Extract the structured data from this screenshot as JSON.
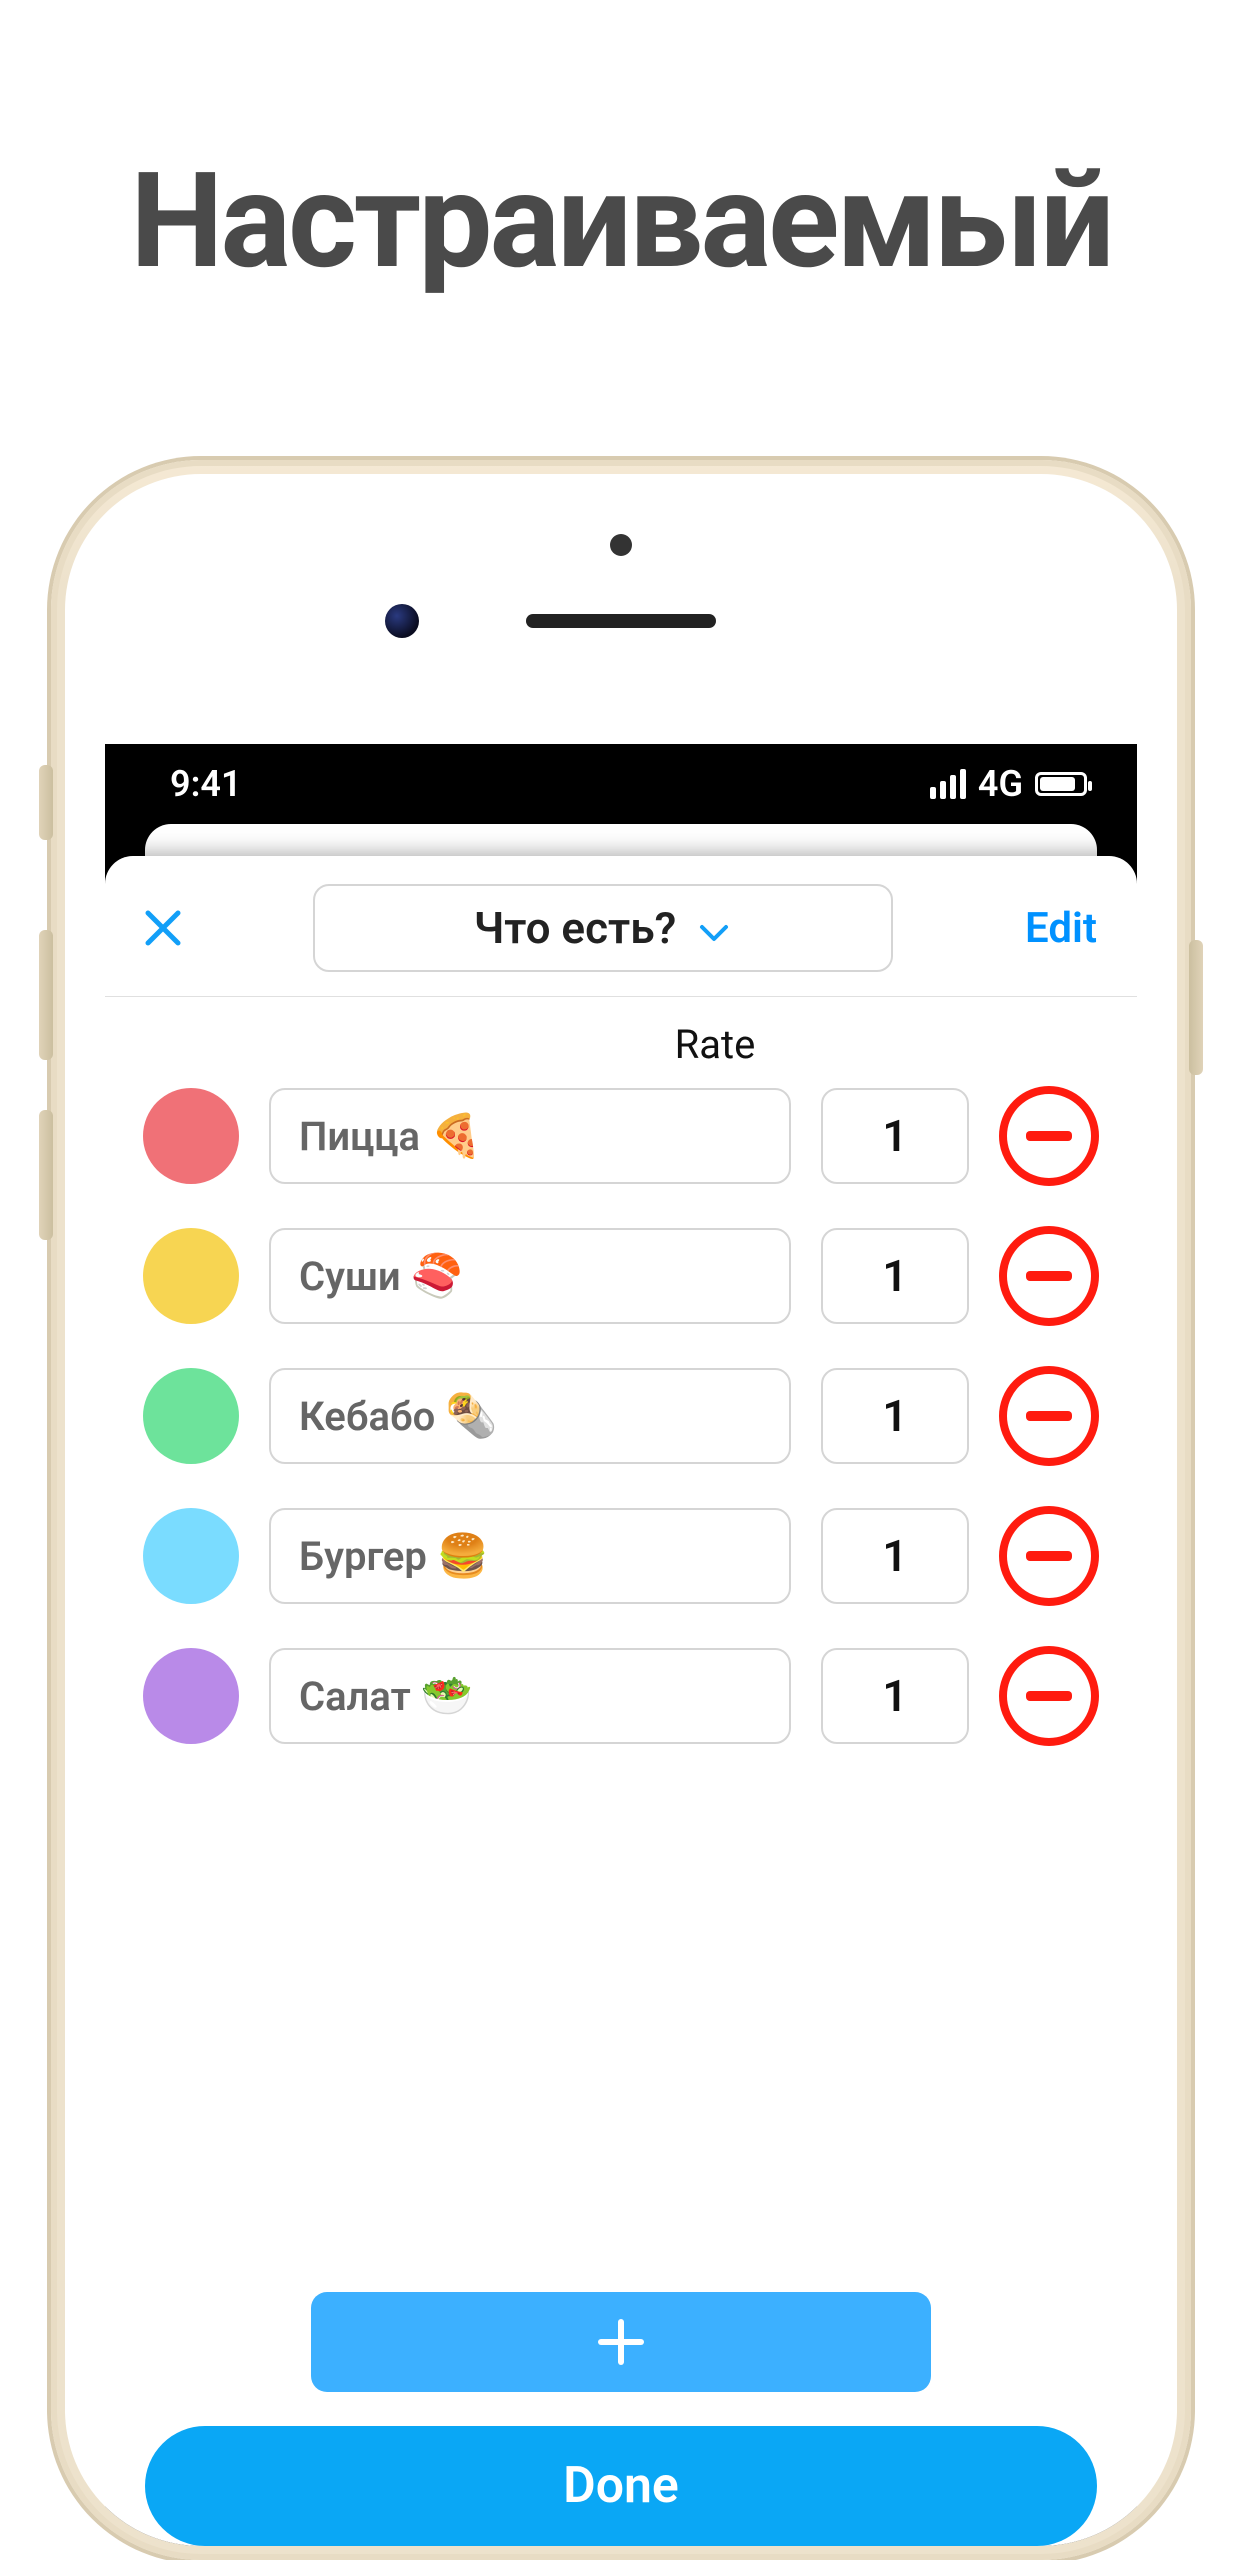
{
  "hero_title": "Настраиваемый",
  "status": {
    "time": "9:41",
    "network_label": "4G"
  },
  "sheet": {
    "title": "Что есть?",
    "edit_label": "Edit",
    "rate_header": "Rate",
    "items": [
      {
        "color": "#f07177",
        "name": "Пицца",
        "emoji": "🍕",
        "rate": "1"
      },
      {
        "color": "#f7d552",
        "name": "Суши",
        "emoji": "🍣",
        "rate": "1"
      },
      {
        "color": "#6de39b",
        "name": "Кебабо",
        "emoji": "🌯",
        "rate": "1"
      },
      {
        "color": "#7adcff",
        "name": "Бургер",
        "emoji": "🍔",
        "rate": "1"
      },
      {
        "color": "#b98ae8",
        "name": "Салат",
        "emoji": "🥗",
        "rate": "1"
      }
    ],
    "done_label": "Done"
  }
}
